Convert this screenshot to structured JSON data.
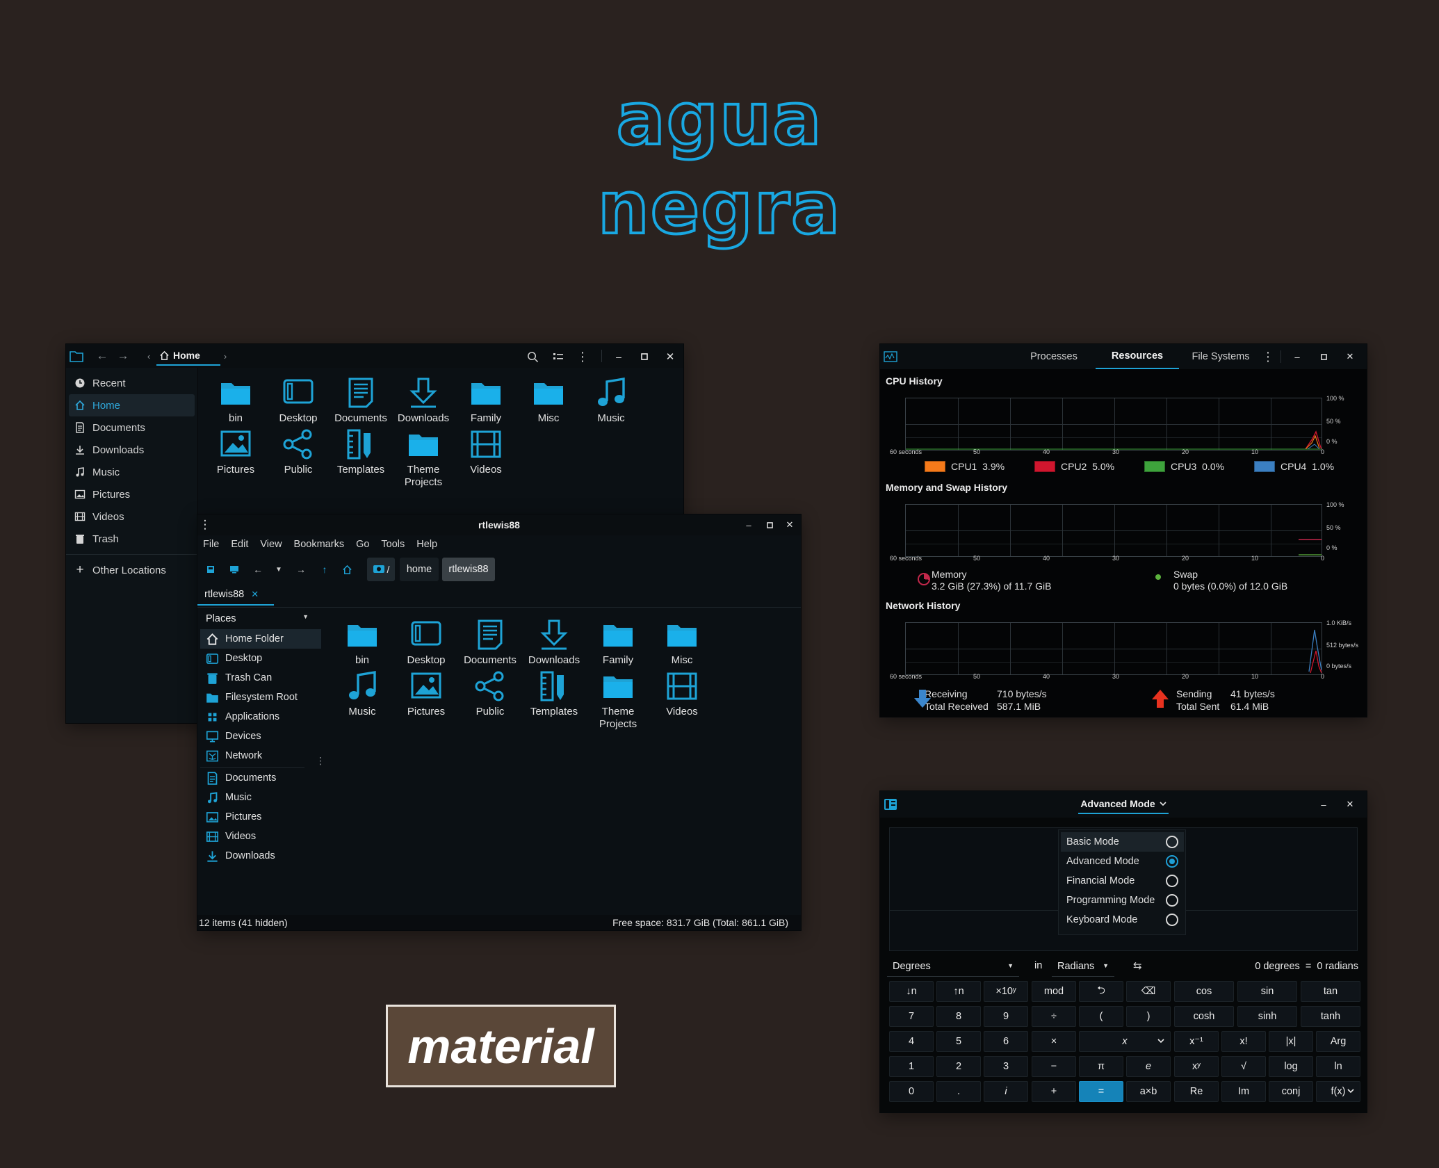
{
  "banner": {
    "line1": "agua",
    "line2": "negra",
    "badge": "material",
    "accent": "#19a8e2",
    "badge_bg": "#5a4738"
  },
  "nautilus": {
    "path_label": "Home",
    "sidebar": [
      {
        "label": "Recent",
        "icon": "clock-icon"
      },
      {
        "label": "Home",
        "icon": "home-icon"
      },
      {
        "label": "Documents",
        "icon": "document-icon"
      },
      {
        "label": "Downloads",
        "icon": "download-icon"
      },
      {
        "label": "Music",
        "icon": "music-icon"
      },
      {
        "label": "Pictures",
        "icon": "picture-icon"
      },
      {
        "label": "Videos",
        "icon": "video-icon"
      },
      {
        "label": "Trash",
        "icon": "trash-icon"
      }
    ],
    "other_locations": "Other Locations",
    "files": [
      {
        "label": "bin",
        "icon": "folder"
      },
      {
        "label": "Desktop",
        "icon": "desktop"
      },
      {
        "label": "Documents",
        "icon": "document"
      },
      {
        "label": "Downloads",
        "icon": "download"
      },
      {
        "label": "Family",
        "icon": "folder"
      },
      {
        "label": "Misc",
        "icon": "folder"
      },
      {
        "label": "Music",
        "icon": "music"
      },
      {
        "label": "Pictures",
        "icon": "picture"
      },
      {
        "label": "Public",
        "icon": "share"
      },
      {
        "label": "Templates",
        "icon": "template"
      },
      {
        "label": "Theme\nProjects",
        "icon": "folder"
      },
      {
        "label": "Videos",
        "icon": "video"
      }
    ]
  },
  "nemo": {
    "title": "rtlewis88",
    "menu": [
      "File",
      "Edit",
      "View",
      "Bookmarks",
      "Go",
      "Tools",
      "Help"
    ],
    "crumbs": {
      "root": "/",
      "home": "home",
      "user": "rtlewis88"
    },
    "tab": "rtlewis88",
    "places_label": "Places",
    "places": [
      {
        "label": "Home Folder",
        "icon": "home-icon"
      },
      {
        "label": "Desktop",
        "icon": "desktop-icon"
      },
      {
        "label": "Trash Can",
        "icon": "trash-icon"
      },
      {
        "label": "Filesystem Root",
        "icon": "folder-icon"
      },
      {
        "label": "Applications",
        "icon": "apps-icon"
      },
      {
        "label": "Devices",
        "icon": "monitor-icon"
      },
      {
        "label": "Network",
        "icon": "network-icon"
      },
      {
        "label": "Documents",
        "icon": "document-icon"
      },
      {
        "label": "Music",
        "icon": "music-icon"
      },
      {
        "label": "Pictures",
        "icon": "picture-icon"
      },
      {
        "label": "Videos",
        "icon": "video-icon"
      },
      {
        "label": "Downloads",
        "icon": "download-icon"
      }
    ],
    "files": [
      {
        "label": "bin",
        "icon": "folder"
      },
      {
        "label": "Desktop",
        "icon": "desktop"
      },
      {
        "label": "Documents",
        "icon": "document"
      },
      {
        "label": "Downloads",
        "icon": "download"
      },
      {
        "label": "Family",
        "icon": "folder"
      },
      {
        "label": "Misc",
        "icon": "folder"
      },
      {
        "label": "Music",
        "icon": "music"
      },
      {
        "label": "Pictures",
        "icon": "picture"
      },
      {
        "label": "Public",
        "icon": "share"
      },
      {
        "label": "Templates",
        "icon": "template"
      },
      {
        "label": "Theme\nProjects",
        "icon": "folder"
      },
      {
        "label": "Videos",
        "icon": "video"
      }
    ],
    "status_left": "12 items (41 hidden)",
    "status_right": "Free space: 831.7 GiB (Total: 861.1 GiB)"
  },
  "sysmon": {
    "tabs": [
      "Processes",
      "Resources",
      "File Systems"
    ],
    "active_tab": "Resources",
    "cpu_title": "CPU History",
    "mem_title": "Memory and Swap History",
    "net_title": "Network History",
    "x_ticks": [
      "60 seconds",
      "50",
      "40",
      "30",
      "20",
      "10",
      "0"
    ],
    "pct_ticks": [
      "100 %",
      "50 %",
      "0 %"
    ],
    "net_ticks": [
      "1.0 KiB/s",
      "512 bytes/s",
      "0 bytes/s"
    ],
    "cpus": [
      {
        "name": "CPU1",
        "value": "3.9%",
        "color": "#f57a1a"
      },
      {
        "name": "CPU2",
        "value": "5.0%",
        "color": "#d0162e"
      },
      {
        "name": "CPU3",
        "value": "0.0%",
        "color": "#3ea33c"
      },
      {
        "name": "CPU4",
        "value": "1.0%",
        "color": "#3b7fc1"
      }
    ],
    "memory": {
      "label": "Memory",
      "value": "3.2 GiB (27.3%) of 11.7 GiB",
      "color": "#c3284b"
    },
    "swap": {
      "label": "Swap",
      "value": "0 bytes (0.0%) of 12.0 GiB",
      "color": "#5cb23d"
    },
    "receiving": {
      "label": "Receiving",
      "rate": "710 bytes/s",
      "total_label": "Total Received",
      "total": "587.1 MiB"
    },
    "sending": {
      "label": "Sending",
      "rate": "41 bytes/s",
      "total_label": "Total Sent",
      "total": "61.4 MiB"
    }
  },
  "calc": {
    "mode_button": "Advanced Mode",
    "modes": [
      "Basic Mode",
      "Advanced Mode",
      "Financial Mode",
      "Programming Mode",
      "Keyboard Mode"
    ],
    "selected_mode": "Advanced Mode",
    "from_unit": "Degrees",
    "in_label": "in",
    "to_unit": "Radians",
    "swap_glyph": "⇆",
    "conversion": "0 degrees  =  0 radians",
    "keys": [
      [
        "↓n",
        "↑n",
        "×10ʸ",
        "mod",
        "⮌",
        "⌫",
        "cos",
        "sin",
        "tan"
      ],
      [
        "7",
        "8",
        "9",
        "÷",
        "(",
        ")",
        "cosh",
        "sinh",
        "tanh"
      ],
      [
        "4",
        "5",
        "6",
        "×",
        "x",
        "x⁻¹",
        "x!",
        "|x|",
        "Arg"
      ],
      [
        "1",
        "2",
        "3",
        "−",
        "π",
        "e",
        "xʸ",
        "√",
        "log",
        "ln"
      ],
      [
        "0",
        ".",
        "i",
        "+",
        "=",
        "a×b",
        "Re",
        "Im",
        "conj",
        "f(x)"
      ]
    ]
  }
}
